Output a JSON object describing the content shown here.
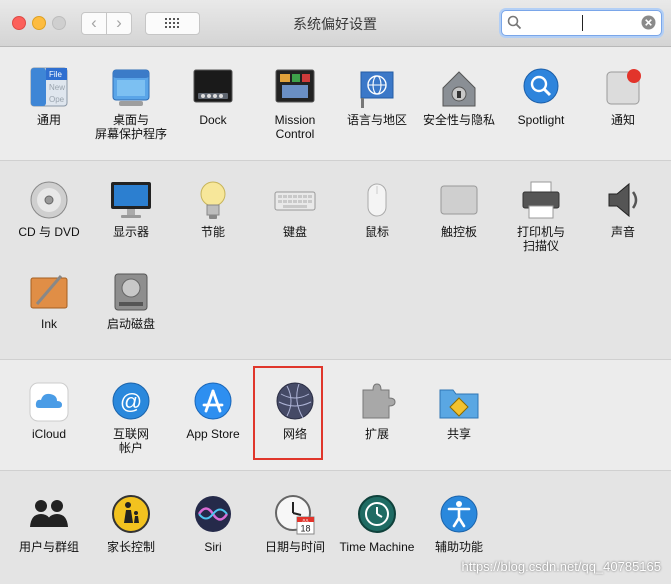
{
  "window": {
    "title": "系统偏好设置"
  },
  "toolbar": {
    "back_glyph": "‹",
    "forward_glyph": "›"
  },
  "search": {
    "value": "",
    "placeholder": ""
  },
  "sections": {
    "personal": [
      {
        "label": "通用",
        "icon": "general-icon"
      },
      {
        "label": "桌面与\n屏幕保护程序",
        "icon": "desktop-screensaver-icon"
      },
      {
        "label": "Dock",
        "icon": "dock-icon"
      },
      {
        "label": "Mission\nControl",
        "icon": "mission-control-icon"
      },
      {
        "label": "语言与地区",
        "icon": "language-region-icon"
      },
      {
        "label": "安全性与隐私",
        "icon": "security-privacy-icon"
      },
      {
        "label": "Spotlight",
        "icon": "spotlight-icon"
      },
      {
        "label": "通知",
        "icon": "notifications-icon"
      }
    ],
    "hardware": [
      {
        "label": "CD 与 DVD",
        "icon": "cd-dvd-icon"
      },
      {
        "label": "显示器",
        "icon": "displays-icon"
      },
      {
        "label": "节能",
        "icon": "energy-saver-icon"
      },
      {
        "label": "键盘",
        "icon": "keyboard-icon"
      },
      {
        "label": "鼠标",
        "icon": "mouse-icon"
      },
      {
        "label": "触控板",
        "icon": "trackpad-icon"
      },
      {
        "label": "打印机与\n扫描仪",
        "icon": "printers-scanners-icon"
      },
      {
        "label": "声音",
        "icon": "sound-icon"
      },
      {
        "label": "Ink",
        "icon": "ink-icon"
      },
      {
        "label": "启动磁盘",
        "icon": "startup-disk-icon"
      }
    ],
    "internet": [
      {
        "label": "iCloud",
        "icon": "icloud-icon"
      },
      {
        "label": "互联网\n帐户",
        "icon": "internet-accounts-icon"
      },
      {
        "label": "App Store",
        "icon": "app-store-icon"
      },
      {
        "label": "网络",
        "icon": "network-icon"
      },
      {
        "label": "扩展",
        "icon": "extensions-icon"
      },
      {
        "label": "共享",
        "icon": "sharing-icon"
      }
    ],
    "system": [
      {
        "label": "用户与群组",
        "icon": "users-groups-icon"
      },
      {
        "label": "家长控制",
        "icon": "parental-controls-icon"
      },
      {
        "label": "Siri",
        "icon": "siri-icon"
      },
      {
        "label": "日期与时间",
        "icon": "date-time-icon"
      },
      {
        "label": "Time Machine",
        "icon": "time-machine-icon"
      },
      {
        "label": "辅助功能",
        "icon": "accessibility-icon"
      }
    ]
  },
  "icon_text": {
    "file_label": "File",
    "new_label": "New",
    "ope_label": "Ope",
    "calendar_month": "JUL",
    "calendar_day": "18"
  },
  "watermark": "https://blog.csdn.net/qq_40785165",
  "colors": {
    "highlight": "#e0362b",
    "search_focus": "#7aa6e9"
  }
}
